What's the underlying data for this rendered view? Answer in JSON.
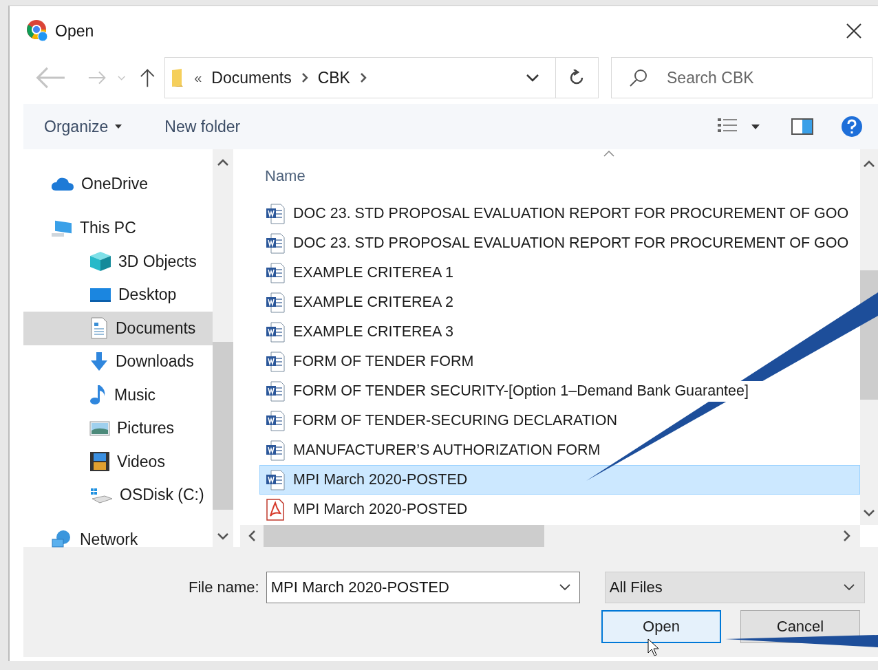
{
  "window": {
    "title": "Open"
  },
  "address": {
    "overflow": "«",
    "path": [
      "Documents",
      "CBK"
    ]
  },
  "search": {
    "placeholder": "Search CBK"
  },
  "toolbar": {
    "organize": "Organize",
    "new_folder": "New folder"
  },
  "sidebar": {
    "items": [
      {
        "label": "OneDrive",
        "kind": "cloud",
        "selected": false
      },
      {
        "label": "This PC",
        "kind": "pc",
        "selected": false,
        "children": [
          {
            "label": "3D Objects",
            "kind": "cube",
            "selected": false
          },
          {
            "label": "Desktop",
            "kind": "desktop",
            "selected": false
          },
          {
            "label": "Documents",
            "kind": "documents",
            "selected": true
          },
          {
            "label": "Downloads",
            "kind": "download",
            "selected": false
          },
          {
            "label": "Music",
            "kind": "music",
            "selected": false
          },
          {
            "label": "Pictures",
            "kind": "pictures",
            "selected": false
          },
          {
            "label": "Videos",
            "kind": "videos",
            "selected": false
          },
          {
            "label": "OSDisk (C:)",
            "kind": "disk",
            "selected": false
          }
        ]
      },
      {
        "label": "Network",
        "kind": "network",
        "selected": false
      }
    ]
  },
  "files": {
    "column": "Name",
    "rows": [
      {
        "name": "DOC 23. STD PROPOSAL EVALUATION REPORT FOR PROCUREMENT OF GOO",
        "kind": "word",
        "selected": false
      },
      {
        "name": "DOC 23. STD PROPOSAL EVALUATION REPORT FOR PROCUREMENT OF GOO",
        "kind": "word",
        "selected": false
      },
      {
        "name": "EXAMPLE CRITEREA 1",
        "kind": "word",
        "selected": false
      },
      {
        "name": "EXAMPLE CRITEREA 2",
        "kind": "word",
        "selected": false
      },
      {
        "name": "EXAMPLE CRITEREA 3",
        "kind": "word",
        "selected": false
      },
      {
        "name": "FORM OF TENDER FORM",
        "kind": "word",
        "selected": false
      },
      {
        "name": "FORM OF TENDER SECURITY-[Option 1–Demand Bank Guarantee]",
        "kind": "word",
        "selected": false
      },
      {
        "name": "FORM OF TENDER-SECURING DECLARATION",
        "kind": "word",
        "selected": false
      },
      {
        "name": "MANUFACTURER’S AUTHORIZATION FORM",
        "kind": "word",
        "selected": false
      },
      {
        "name": "MPI March 2020-POSTED",
        "kind": "word",
        "selected": true
      },
      {
        "name": "MPI March 2020-POSTED",
        "kind": "pdf",
        "selected": false
      }
    ]
  },
  "footer": {
    "file_name_label": "File name:",
    "file_name": "MPI March 2020-POSTED",
    "file_type": "All Files",
    "buttons": [
      {
        "label": "Open",
        "default": true
      },
      {
        "label": "Cancel",
        "default": false
      }
    ]
  }
}
